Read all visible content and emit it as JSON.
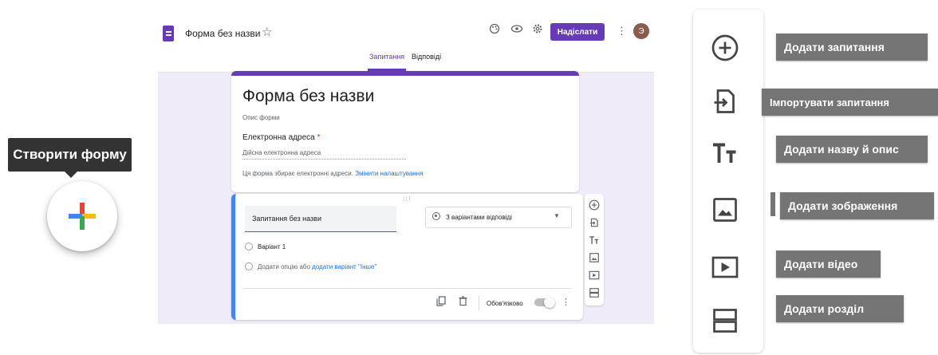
{
  "tooltip": {
    "text": "Створити форму"
  },
  "forms_window": {
    "doc_title": "Форма без назви",
    "send_label": "Надіслати",
    "avatar_initial": "Э",
    "tabs": [
      {
        "label": "Запитання",
        "active": true
      },
      {
        "label": "Відповіді",
        "active": false
      }
    ],
    "title_card": {
      "title": "Форма без назви",
      "description": "Опис форми",
      "email_label": "Електронна адреса",
      "required_mark": "*",
      "email_placeholder": "Дійсна електронна адреса",
      "collect_note": "Ця форма збирає електронні адреси.",
      "change_settings": "Змінити налаштування"
    },
    "question_card": {
      "question_text": "Запитання без назви",
      "type_label": "З варіантами відповіді",
      "option1": "Варіант 1",
      "add_option": "Додати опцію",
      "or_text": "або",
      "add_other": "додати варіант \"Інше\"",
      "required_label": "Обов'язково"
    }
  },
  "big_toolbar": {
    "labels": {
      "add_question": "Додати запитання",
      "import_questions": "Імпортувати запитання",
      "add_title": "Додати назву й опис",
      "add_image": "Додати зображення",
      "add_video": "Додати відео",
      "add_section": "Додати розділ"
    }
  },
  "colors": {
    "primary": "#673ab7",
    "background": "#f0ebf8",
    "question_accent": "#4285f4",
    "tooltip_bg": "#333333",
    "label_bg": "#757575"
  }
}
